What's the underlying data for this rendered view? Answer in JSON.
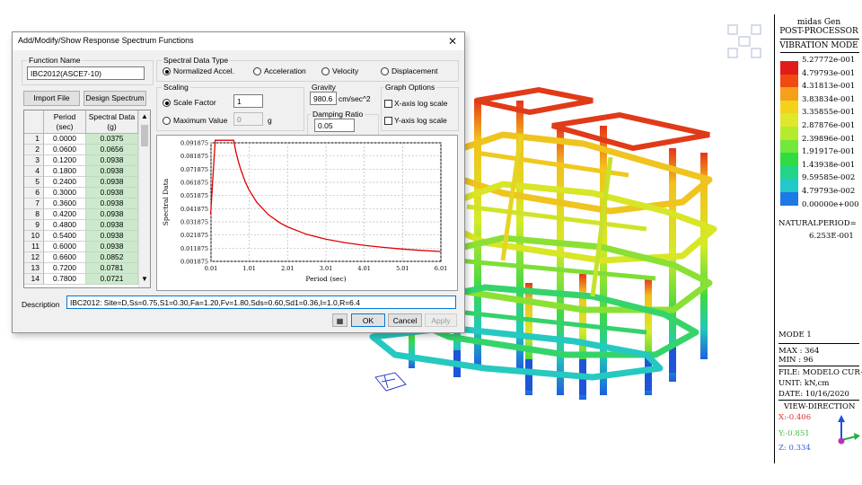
{
  "dialog": {
    "title": "Add/Modify/Show Response Spectrum Functions",
    "close_glyph": "✕",
    "function_name_label": "Function Name",
    "function_name_value": "IBC2012(ASCE7-10)",
    "import_file_label": "Import File",
    "design_spectrum_label": "Design Spectrum",
    "spectral_type_label": "Spectral Data Type",
    "spectral_types": [
      "Normalized Accel.",
      "Acceleration",
      "Velocity",
      "Displacement"
    ],
    "spectral_type_selected": "Normalized Accel.",
    "scaling_label": "Scaling",
    "scale_factor_label": "Scale Factor",
    "scale_factor_value": "1",
    "max_value_label": "Maximum Value",
    "max_value_value": "0",
    "max_value_unit": "g",
    "gravity_label": "Gravity",
    "gravity_value": "980.6",
    "gravity_unit": "cm/sec^2",
    "damping_label": "Damping Ratio",
    "damping_value": "0.05",
    "graph_options_label": "Graph Options",
    "x_log_label": "X-axis log scale",
    "y_log_label": "Y-axis log scale",
    "description_label": "Description",
    "description_value": "IBC2012: Site=D,Ss=0.75,S1=0.30,Fa=1.20,Fv=1.80,Sds=0.60,Sd1=0.36,I=1.0,R=6.4",
    "ok_label": "OK",
    "cancel_label": "Cancel",
    "apply_label": "Apply",
    "table": {
      "headers": [
        "Period\n(sec)",
        "Spectral Data\n(g)"
      ],
      "rows": [
        [
          "1",
          "0.0000",
          "0.0375"
        ],
        [
          "2",
          "0.0600",
          "0.0656"
        ],
        [
          "3",
          "0.1200",
          "0.0938"
        ],
        [
          "4",
          "0.1800",
          "0.0938"
        ],
        [
          "5",
          "0.2400",
          "0.0938"
        ],
        [
          "6",
          "0.3000",
          "0.0938"
        ],
        [
          "7",
          "0.3600",
          "0.0938"
        ],
        [
          "8",
          "0.4200",
          "0.0938"
        ],
        [
          "9",
          "0.4800",
          "0.0938"
        ],
        [
          "10",
          "0.5400",
          "0.0938"
        ],
        [
          "11",
          "0.6000",
          "0.0938"
        ],
        [
          "12",
          "0.6600",
          "0.0852"
        ],
        [
          "13",
          "0.7200",
          "0.0781"
        ],
        [
          "14",
          "0.7800",
          "0.0721"
        ]
      ]
    }
  },
  "chart_data": {
    "type": "line",
    "title": "",
    "xlabel": "Period (sec)",
    "ylabel": "Spectral Data",
    "x_ticks": [
      "0.01",
      "1.01",
      "2.01",
      "3.01",
      "4.01",
      "5.01",
      "6.01"
    ],
    "y_ticks": [
      "0.001875",
      "0.011875",
      "0.021875",
      "0.031875",
      "0.041875",
      "0.051875",
      "0.061875",
      "0.071875",
      "0.081875",
      "0.091875"
    ],
    "xlim": [
      0.01,
      6.01
    ],
    "ylim": [
      0.001875,
      0.091875
    ],
    "grid": true,
    "line_color": "#e00000",
    "series": [
      {
        "x": [
          0.0,
          0.06,
          0.12,
          0.24,
          0.36,
          0.48,
          0.6,
          0.66,
          0.72,
          0.78,
          0.9,
          1.0,
          1.2,
          1.5,
          1.8,
          2.0,
          2.5,
          3.0,
          3.5,
          4.0,
          4.5,
          5.0,
          5.5,
          6.0
        ],
        "y": [
          0.0375,
          0.0656,
          0.0938,
          0.0938,
          0.0938,
          0.0938,
          0.0938,
          0.0852,
          0.0781,
          0.0721,
          0.0625,
          0.05625,
          0.0469,
          0.0375,
          0.03125,
          0.0281,
          0.0225,
          0.01875,
          0.0161,
          0.0141,
          0.0125,
          0.01125,
          0.0102,
          0.0094
        ]
      }
    ]
  },
  "legend": {
    "program": "midas Gen",
    "mode_label": "POST-PROCESSOR",
    "result_type": "VIBRATION MODE",
    "values": [
      "5.27772e-001",
      "4.79793e-001",
      "4.31813e-001",
      "3.83834e-001",
      "3.35855e-001",
      "2.87876e-001",
      "2.39896e-001",
      "1.91917e-001",
      "1.43938e-001",
      "9.59585e-002",
      "4.79793e-002",
      "0.00000e+000"
    ],
    "colors": [
      "#e11a1a",
      "#f04a10",
      "#f5a01a",
      "#f5d21a",
      "#dfe82a",
      "#b4ec2c",
      "#74e83a",
      "#2fdc42",
      "#22d48a",
      "#23c8c8",
      "#1e78e6",
      "#ffffff"
    ],
    "period_label": "NATURALPERIOD=",
    "period_value": "6.253E-001",
    "mode_name": "MODE 1",
    "max_text": "MAX : 364",
    "min_text": "MIN : 96",
    "file_text": "FILE: MODELO CUR~",
    "unit_text": "UNIT: kN,cm",
    "date_text": "DATE: 10/16/2020",
    "view_label": "VIEW-DIRECTION",
    "view_x": "X:-0.406",
    "view_y": "Y:-0.851",
    "view_z": "Z: 0.334",
    "view_x_color": "#e03030",
    "view_y_color": "#40c040",
    "view_z_color": "#3060e0"
  }
}
